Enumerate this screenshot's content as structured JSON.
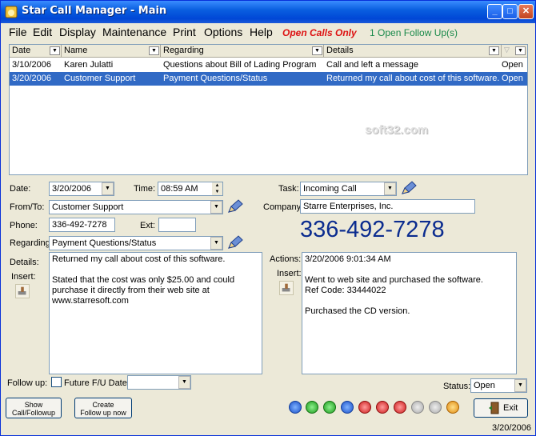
{
  "window": {
    "title": "Star Call Manager - Main"
  },
  "menu": {
    "items": [
      "File",
      "Edit",
      "Display",
      "Maintenance",
      "Print",
      "Options",
      "Help"
    ],
    "open_calls": "Open Calls Only",
    "followups": "1  Open Follow Up(s)"
  },
  "grid": {
    "columns": [
      "Date",
      "Name",
      "Regarding",
      "Details"
    ],
    "rows": [
      {
        "date": "3/10/2006",
        "name": "Karen Julatti",
        "regarding": "Questions about Bill of Lading Program",
        "details": "Call and left a message",
        "status": "Open"
      },
      {
        "date": "3/20/2006",
        "name": "Customer Support",
        "regarding": "Payment Questions/Status",
        "details": "Returned my call about cost of this software.",
        "status": "Open"
      }
    ],
    "watermark": "soft32.com"
  },
  "form": {
    "date_label": "Date:",
    "date": "3/20/2006",
    "time_label": "Time:",
    "time": "08:59 AM",
    "task_label": "Task:",
    "task": "Incoming Call",
    "from_label": "From/To:",
    "from": "Customer Support",
    "company_label": "Company:",
    "company": "Starre Enterprises, Inc.",
    "phone_label": "Phone:",
    "phone": "336-492-7278",
    "ext_label": "Ext:",
    "ext": "",
    "big_phone": "336-492-7278",
    "regarding_label": "Regarding:",
    "regarding": "Payment Questions/Status",
    "details_label": "Details:",
    "insert_label": "Insert:",
    "details": "Returned my call about cost of this software.\n\nStated that the cost was only $25.00 and could purchase it directly from their web site at www.starresoft.com",
    "actions_label": "Actions:",
    "actions": "3/20/2006 9:01:34 AM\n\nWent to web site and purchased the software.\nRef Code: 33444022\n\nPurchased the CD version.",
    "followup_label": "Follow up:",
    "future_label": "Future F/U Date:",
    "future_date": "",
    "status_label": "Status:",
    "status": "Open"
  },
  "buttons": {
    "show": "Show\nCall/Followup",
    "create": "Create\nFollow up now",
    "exit": "Exit"
  },
  "footer": {
    "date": "3/20/2006"
  }
}
